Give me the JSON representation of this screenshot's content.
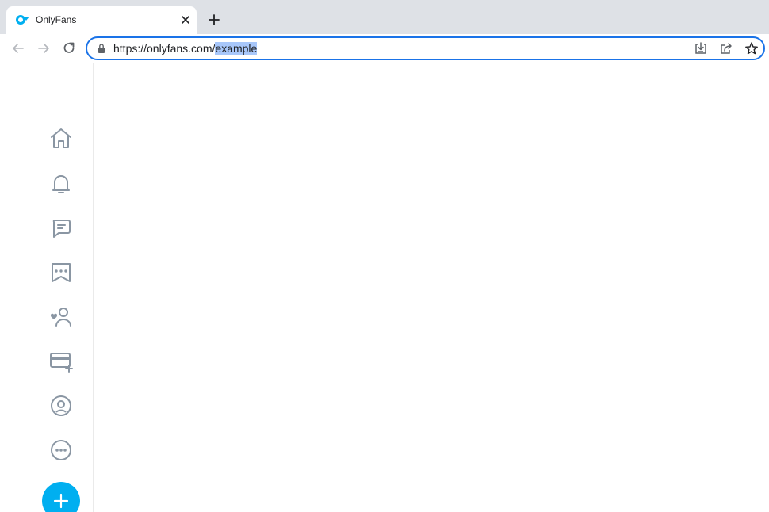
{
  "browser": {
    "tab": {
      "title": "OnlyFans",
      "favicon": "onlyfans-logo-icon"
    },
    "toolbar": {
      "back": "arrow-left-icon",
      "forward": "arrow-right-icon",
      "reload": "reload-icon",
      "lock": "lock-icon",
      "install": "install-app-icon",
      "share": "share-icon",
      "bookmark": "star-icon"
    },
    "address": {
      "url_prefix": "https://onlyfans.com/",
      "url_selected": "example"
    }
  },
  "sidebar": {
    "items": [
      {
        "name": "home-icon"
      },
      {
        "name": "bell-icon"
      },
      {
        "name": "messages-icon"
      },
      {
        "name": "bookmarks-icon"
      },
      {
        "name": "user-lists-icon"
      },
      {
        "name": "add-card-icon"
      },
      {
        "name": "profile-icon"
      },
      {
        "name": "more-icon"
      }
    ],
    "fab": "plus-icon"
  },
  "colors": {
    "brand": "#00aff0",
    "icon_gray": "#8a96a3",
    "selection": "#a8c7fa",
    "focus_ring": "#1a73e8"
  }
}
